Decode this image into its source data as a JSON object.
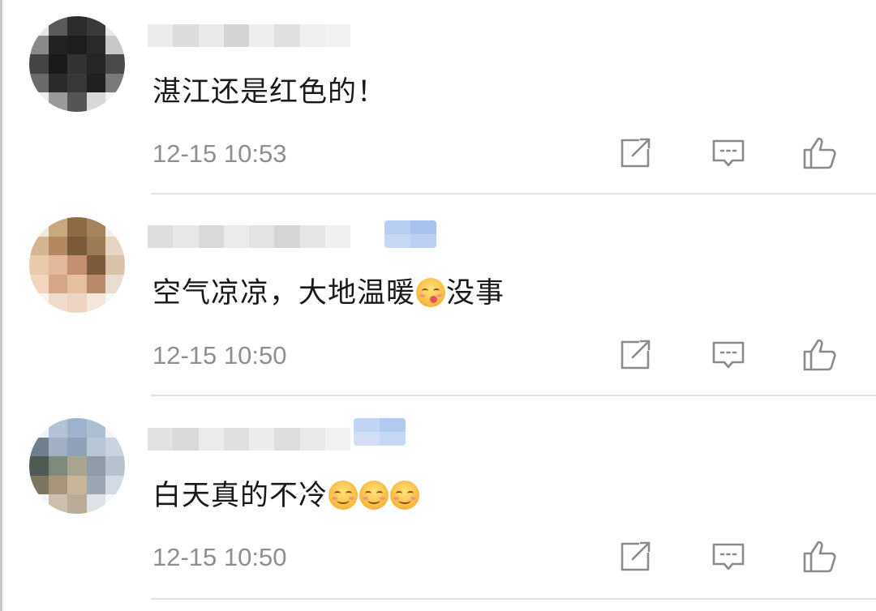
{
  "comments": [
    {
      "text": "湛江还是红色的！",
      "time": "12-15 10:53",
      "emoji_after": []
    },
    {
      "text": "空气凉凉，大地温暖",
      "text_after": "没事",
      "time": "12-15 10:50",
      "emoji_inline": "savoring-food-emoji"
    },
    {
      "text": "白天真的不冷",
      "time": "12-15 10:50",
      "emoji_after": [
        "smiling-face-emoji",
        "smiling-face-emoji",
        "smiling-face-emoji"
      ]
    }
  ],
  "icons": {
    "share": "share-icon",
    "reply": "comment-icon",
    "like": "thumbs-up-icon"
  },
  "colors": {
    "text": "#1a1a1a",
    "meta": "#8f8f8f",
    "icon": "#8a8a8a",
    "divider": "#e2e2e2"
  }
}
